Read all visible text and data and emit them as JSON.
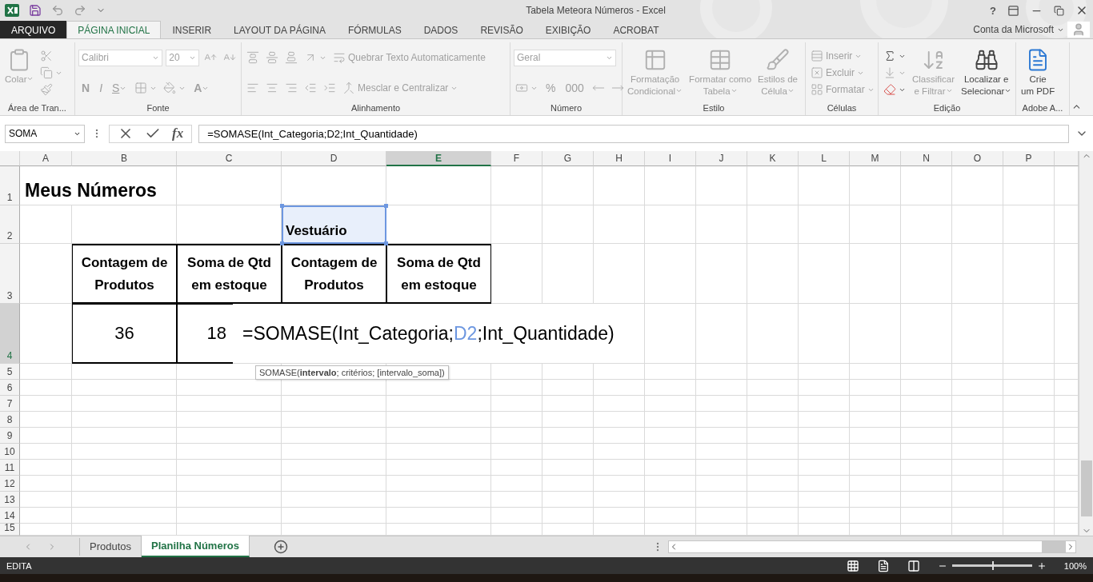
{
  "title_bar": {
    "title": "Tabela Meteora Números - Excel",
    "help": "?"
  },
  "ribbon_tabs": [
    {
      "label": "ARQUIVO",
      "kind": "file",
      "selected": false
    },
    {
      "label": "PÁGINA INICIAL",
      "kind": "tab",
      "selected": true
    },
    {
      "label": "INSERIR",
      "kind": "tab",
      "selected": false
    },
    {
      "label": "LAYOUT DA PÁGINA",
      "kind": "tab",
      "selected": false
    },
    {
      "label": "FÓRMULAS",
      "kind": "tab",
      "selected": false
    },
    {
      "label": "DADOS",
      "kind": "tab",
      "selected": false
    },
    {
      "label": "REVISÃO",
      "kind": "tab",
      "selected": false
    },
    {
      "label": "EXIBIÇÃO",
      "kind": "tab",
      "selected": false
    },
    {
      "label": "ACROBAT",
      "kind": "tab",
      "selected": false
    }
  ],
  "account": {
    "label": "Conta da Microsoft"
  },
  "ribbon_groups": [
    {
      "label": "Área de Tran...",
      "rows": [
        {
          "items": [
            {
              "kind": "paste",
              "label": "Colar",
              "disabled": true
            },
            {
              "kind": "stack",
              "items": [
                {
                  "kind": "cut",
                  "disabled": true
                },
                {
                  "kind": "copy",
                  "disabled": true
                },
                {
                  "kind": "painter",
                  "disabled": true
                }
              ]
            }
          ]
        }
      ]
    },
    {
      "label": "Fonte",
      "rows": [
        {
          "items": [
            {
              "kind": "font-name",
              "label": "Calibri",
              "disabled": true
            },
            {
              "kind": "font-size",
              "label": "20",
              "disabled": true
            },
            {
              "kind": "grow",
              "disabled": true
            },
            {
              "kind": "shrink",
              "disabled": true
            }
          ]
        },
        {
          "items": [
            {
              "kind": "bold",
              "label": "N",
              "disabled": true
            },
            {
              "kind": "italic",
              "label": "I",
              "disabled": true
            },
            {
              "kind": "underline",
              "label": "S",
              "disabled": true
            },
            {
              "kind": "borders",
              "disabled": true
            },
            {
              "kind": "fill",
              "disabled": true
            },
            {
              "kind": "font-color",
              "label": "A",
              "disabled": true
            }
          ]
        }
      ]
    },
    {
      "label": "Alinhamento",
      "rows": [
        {
          "items": [
            {
              "kind": "align-top",
              "disabled": true
            },
            {
              "kind": "align-middle",
              "disabled": true
            },
            {
              "kind": "align-bottom",
              "disabled": true
            },
            {
              "kind": "orientation",
              "disabled": true
            },
            {
              "kind": "wrap",
              "label": "Quebrar Texto Automaticamente",
              "disabled": true
            }
          ]
        },
        {
          "items": [
            {
              "kind": "align-left",
              "disabled": true
            },
            {
              "kind": "align-center",
              "disabled": true
            },
            {
              "kind": "align-right",
              "disabled": true
            },
            {
              "kind": "outdent",
              "disabled": true
            },
            {
              "kind": "indent",
              "disabled": true
            },
            {
              "kind": "merge",
              "label": "Mesclar e Centralizar",
              "disabled": true
            }
          ]
        }
      ]
    },
    {
      "label": "Número",
      "rows": [
        {
          "items": [
            {
              "kind": "number-format",
              "label": "Geral",
              "disabled": true
            }
          ]
        },
        {
          "items": [
            {
              "kind": "currency",
              "disabled": true
            },
            {
              "kind": "percent",
              "label": "%",
              "disabled": true
            },
            {
              "kind": "thousands",
              "label": "000",
              "disabled": true
            },
            {
              "kind": "inc-decimal",
              "disabled": true
            },
            {
              "kind": "dec-decimal",
              "disabled": true
            }
          ]
        }
      ]
    },
    {
      "label": "Estilo",
      "rows": [
        {
          "items": [
            {
              "kind": "cond-format",
              "label": "Formatação\nCondicional",
              "disabled": true
            },
            {
              "kind": "format-table",
              "label": "Formatar como\nTabela",
              "disabled": true
            },
            {
              "kind": "cell-styles",
              "label": "Estilos de\nCélula",
              "disabled": true
            }
          ]
        }
      ]
    },
    {
      "label": "Células",
      "rows": [
        {
          "items": [
            {
              "kind": "stack",
              "items": [
                {
                  "kind": "insert",
                  "label": "Inserir",
                  "disabled": true
                },
                {
                  "kind": "delete",
                  "label": "Excluir",
                  "disabled": true
                },
                {
                  "kind": "format",
                  "label": "Formatar",
                  "disabled": true
                }
              ]
            }
          ]
        }
      ]
    },
    {
      "label": "Edição",
      "rows": [
        {
          "items": [
            {
              "kind": "stack",
              "items": [
                {
                  "kind": "autosum",
                  "disabled": false
                },
                {
                  "kind": "fill-down",
                  "disabled": true
                },
                {
                  "kind": "clear",
                  "disabled": false
                }
              ]
            },
            {
              "kind": "sort",
              "label": "Classificar\ne Filtrar",
              "disabled": true
            },
            {
              "kind": "find",
              "label": "Localizar e\nSelecionar",
              "disabled": false
            }
          ]
        }
      ]
    },
    {
      "label": "Adobe A...",
      "rows": [
        {
          "items": [
            {
              "kind": "pdf",
              "label": "Crie\num PDF",
              "disabled": false
            }
          ]
        }
      ]
    }
  ],
  "formula_bar": {
    "name_box": "SOMA",
    "fx": "fx",
    "formula": "=SOMASE(Int_Categoria;D2;Int_Quantidade)"
  },
  "sheet": {
    "columns": [
      {
        "letter": "A",
        "selected": false
      },
      {
        "letter": "B",
        "selected": false
      },
      {
        "letter": "C",
        "selected": false
      },
      {
        "letter": "D",
        "selected": false
      },
      {
        "letter": "E",
        "selected": true
      },
      {
        "letter": "F",
        "selected": false
      },
      {
        "letter": "G",
        "selected": false
      },
      {
        "letter": "H",
        "selected": false
      },
      {
        "letter": "I",
        "selected": false
      },
      {
        "letter": "J",
        "selected": false
      },
      {
        "letter": "K",
        "selected": false
      },
      {
        "letter": "L",
        "selected": false
      },
      {
        "letter": "M",
        "selected": false
      },
      {
        "letter": "N",
        "selected": false
      },
      {
        "letter": "O",
        "selected": false
      },
      {
        "letter": "P",
        "selected": false
      }
    ],
    "rows": [
      {
        "number": "1",
        "selected": false,
        "cells": [
          {
            "kind": "title",
            "text": "Meus Números"
          }
        ]
      },
      {
        "number": "2",
        "selected": false,
        "cells": [
          null,
          null,
          null,
          {
            "kind": "referenced",
            "text": "Vestuário"
          }
        ]
      },
      {
        "number": "3",
        "selected": false,
        "cells": [
          null,
          {
            "kind": "header",
            "text": "Contagem de Produtos"
          },
          {
            "kind": "header",
            "text": "Soma de Qtd em estoque"
          },
          {
            "kind": "header",
            "text": "Contagem de Produtos"
          },
          {
            "kind": "header",
            "text": "Soma de Qtd em estoque"
          }
        ]
      },
      {
        "number": "4",
        "selected": true,
        "cells": [
          null,
          {
            "kind": "count",
            "text": "36"
          },
          {
            "kind": "amount",
            "text": "18"
          }
        ]
      },
      {
        "number": "5",
        "selected": false
      },
      {
        "number": "6",
        "selected": false
      },
      {
        "number": "7",
        "selected": false
      },
      {
        "number": "8",
        "selected": false
      },
      {
        "number": "9",
        "selected": false
      },
      {
        "number": "10",
        "selected": false
      },
      {
        "number": "11",
        "selected": false
      },
      {
        "number": "12",
        "selected": false
      },
      {
        "number": "13",
        "selected": false
      },
      {
        "number": "14",
        "selected": false
      },
      {
        "number": "15",
        "selected": false
      }
    ],
    "editing": {
      "parts": [
        {
          "text": "=SOMASE(Int_Categoria;",
          "ref": false
        },
        {
          "text": "D2",
          "ref": true
        },
        {
          "text": ";Int_Quantidade)",
          "ref": false
        }
      ]
    },
    "tooltip": "SOMASE(**intervalo**; critérios; [intervalo_soma])"
  },
  "sheet_tabs": [
    {
      "label": "Produtos",
      "selected": false
    },
    {
      "label": "Planilha Números",
      "selected": true
    }
  ],
  "status_bar": {
    "mode": "EDITA",
    "zoom": {
      "level": 0.5
    },
    "zoom_label": "100%"
  }
}
